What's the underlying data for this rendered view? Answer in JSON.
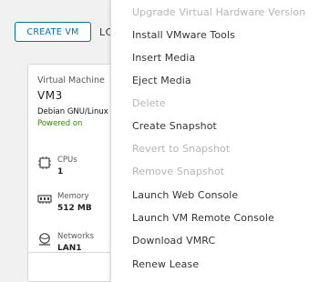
{
  "toolbar": {
    "create_vm_label": "CREATE VM",
    "next_label_partial": "LC"
  },
  "vm_card": {
    "label": "Virtual Machine",
    "name": "VM3",
    "os": "Debian GNU/Linux",
    "status": "Powered on",
    "status_color": "#318700",
    "stats": [
      {
        "label": "CPUs",
        "value": "1",
        "icon": "cpu-icon"
      },
      {
        "label": "Memory",
        "value": "512 MB",
        "icon": "memory-icon"
      },
      {
        "label": "Networks",
        "value": "LAN1",
        "icon": "network-icon"
      }
    ]
  },
  "context_menu": {
    "items": [
      {
        "label": "Upgrade Virtual Hardware Version",
        "enabled": false
      },
      {
        "label": "Install VMware Tools",
        "enabled": true
      },
      {
        "label": "Insert Media",
        "enabled": true
      },
      {
        "label": "Eject Media",
        "enabled": true
      },
      {
        "label": "Delete",
        "enabled": false
      },
      {
        "label": "Create Snapshot",
        "enabled": true
      },
      {
        "label": "Revert to Snapshot",
        "enabled": false
      },
      {
        "label": "Remove Snapshot",
        "enabled": false
      },
      {
        "label": "Launch Web Console",
        "enabled": true
      },
      {
        "label": "Launch VM Remote Console",
        "enabled": true
      },
      {
        "label": "Download VMRC",
        "enabled": true
      },
      {
        "label": "Renew Lease",
        "enabled": true
      }
    ]
  },
  "colors": {
    "accent": "#0072a3",
    "disabled_text": "#b5b5b5",
    "enabled_text": "#333333"
  }
}
